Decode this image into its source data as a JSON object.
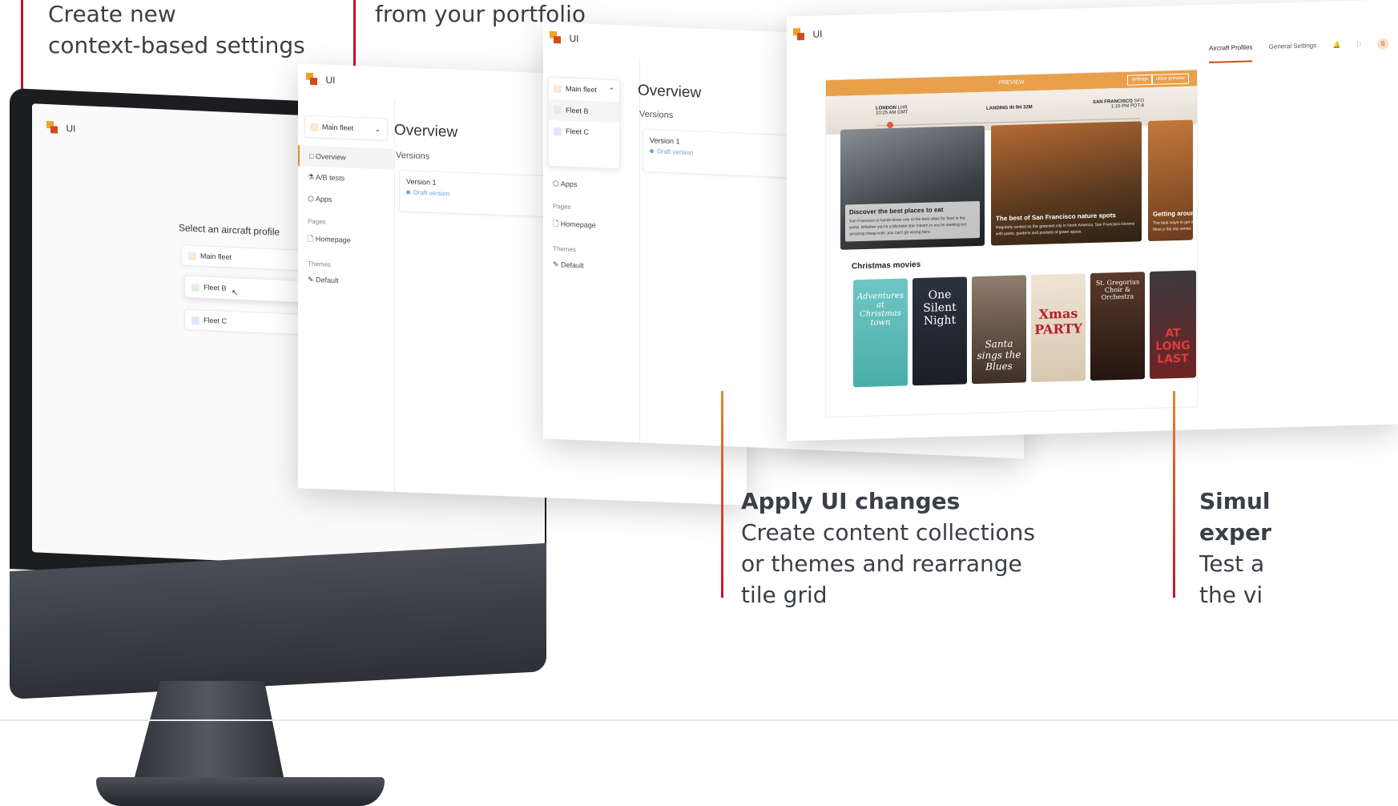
{
  "callouts": {
    "top_left": {
      "line1": "Create new",
      "line2": "context-based settings"
    },
    "top_mid": {
      "line": "from your portfolio"
    },
    "apply": {
      "title": "Apply UI changes",
      "line1": "Create content collections",
      "line2": "or themes and rearrange",
      "line3": "tile grid"
    },
    "simulate": {
      "title1": "Simul",
      "title2": "exper",
      "line1": "Test a",
      "line2": "the vi"
    }
  },
  "app": {
    "title": "UI"
  },
  "monitor_screen": {
    "heading": "Select an aircraft profile",
    "profiles": [
      "Main fleet",
      "Fleet B",
      "Fleet C"
    ]
  },
  "panel_versions": {
    "fleet_selector": "Main fleet",
    "fleet_options": [
      "Fleet B",
      "Fleet C"
    ],
    "nav": {
      "overview": "Overview",
      "ab_tests": "A/B tests",
      "apps": "Apps",
      "pages_section": "Pages",
      "homepage": "Homepage",
      "themes_section": "Themes",
      "default_theme": "Default"
    },
    "heading": "Overview",
    "subheading": "Versions",
    "version": {
      "name": "Version 1",
      "status": "Draft version"
    }
  },
  "preview_panel": {
    "tabs": [
      "Aircraft Profiles",
      "General Settings"
    ],
    "avatar": "S",
    "preview_label": "PREVIEW",
    "settings_btn": "settings",
    "close_btn": "close preview",
    "flight": {
      "origin": "LONDON",
      "origin_code": "LHR",
      "origin_time": "10:25 AM",
      "origin_tz": "GMT",
      "status": "LANDING IN 9H 32M",
      "dest": "SAN FRANCISCO",
      "dest_code": "SFO",
      "dest_time": "1:15 PM",
      "dest_tz": "PDT-8"
    },
    "tiles": [
      {
        "title": "Discover the best places to eat",
        "desc": "San Francisco is hands-down one of the best cities for food in the world. Whether you're a Michelin star maven or you're seeking out amazing cheap eats, you can't go wrong here."
      },
      {
        "title": "The best of San Francisco nature spots",
        "desc": "Regularly ranked as the greenest city in North America, San Francisco blooms with parks, gardens and pockets of green space."
      },
      {
        "title": "Getting around",
        "desc": "The best ways to get transportation. Most p the city center, and th"
      }
    ],
    "section": "Christmas movies",
    "posters": [
      "Adventures at Christmas town",
      "One Silent Night",
      "Santa sings the Blues",
      "Xmas PARTY",
      "St. Gregorius Choir & Orchestra",
      "AT LONG LAST"
    ]
  },
  "colors": {
    "brand_red": "#c8102e",
    "brand_orange": "#e58a2b",
    "accent_bar": "#e8a04a"
  }
}
